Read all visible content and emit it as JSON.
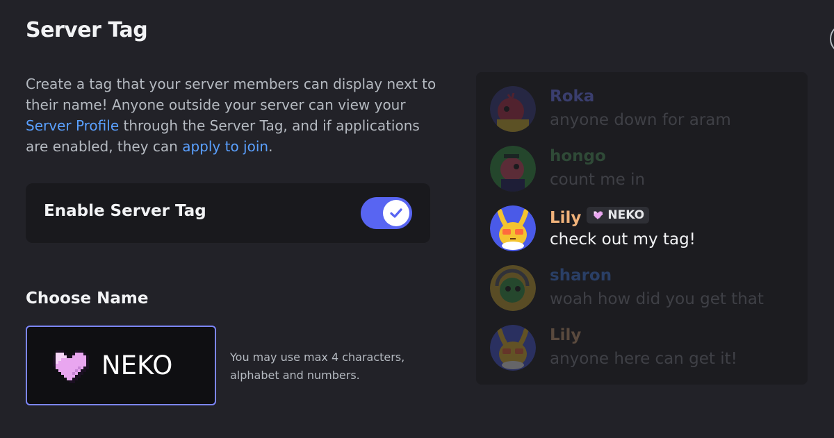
{
  "page": {
    "title": "Server Tag",
    "description": {
      "part1": "Create a tag that your server members can display next to their name! Anyone outside your server can view your ",
      "link1": "Server Profile",
      "part2": " through the Server Tag, and if applications are enabled, they can ",
      "link2": "apply to join",
      "part3": "."
    }
  },
  "toggle": {
    "label": "Enable Server Tag",
    "enabled": true
  },
  "name_section": {
    "label": "Choose Name",
    "tag_value": "NEKO",
    "tag_icon": "pink-heart-icon",
    "hint": "You may use max 4 characters, alphabet and numbers."
  },
  "preview": {
    "messages": [
      {
        "name": "Roka",
        "text": "anyone down for aram",
        "name_color": "#3a3e6e",
        "text_color": "#3f4046",
        "dim": true
      },
      {
        "name": "hongo",
        "text": "count me in",
        "name_color": "#2f4a37",
        "text_color": "#3f4046",
        "dim": true
      },
      {
        "name": "Lily",
        "badge": "NEKO",
        "text": "check out my tag!",
        "name_color": "#f0b27a",
        "text_color": "#f2f3f5",
        "dim": false
      },
      {
        "name": "sharon",
        "text": "woah how did you get that",
        "name_color": "#2a3f66",
        "text_color": "#3f4046",
        "dim": true
      },
      {
        "name": "Lily",
        "text": "anyone here can get it!",
        "name_color": "#5a4a3e",
        "text_color": "#3f4046",
        "dim": true
      }
    ]
  },
  "colors": {
    "accent": "#5865f2",
    "link": "#5aa0ff",
    "background": "#222228"
  }
}
